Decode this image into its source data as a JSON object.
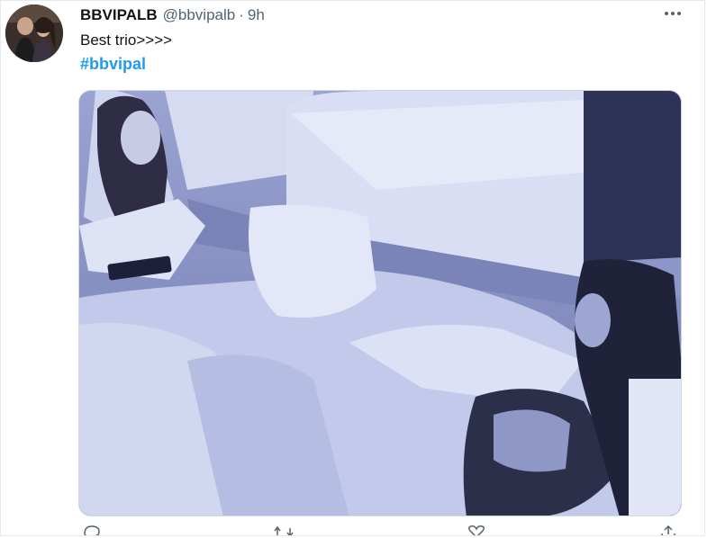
{
  "tweet": {
    "display_name": "BBVIPALB",
    "handle": "@bbvipalb",
    "separator": "·",
    "time": "9h",
    "text": "Best trio>>>>",
    "hashtag": "#bbvipal",
    "more_icon": "more-horizontal-icon"
  },
  "colors": {
    "hashtag": "#1d9bf0",
    "secondary_text": "#536471",
    "media_tint": "#8b95c7"
  },
  "actions": [
    "reply-icon",
    "retweet-icon",
    "like-icon",
    "share-icon"
  ]
}
